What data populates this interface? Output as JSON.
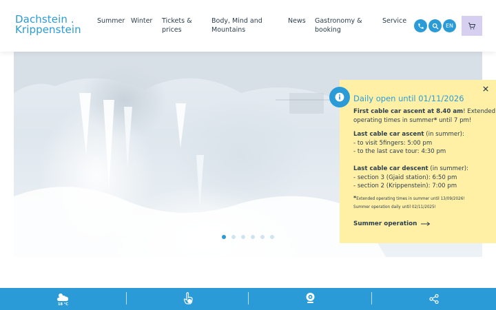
{
  "logo": {
    "line1": "Dachstein .",
    "line2": "Krippenstein"
  },
  "nav": [
    {
      "label": "Summer"
    },
    {
      "label": "Winter"
    },
    {
      "label": "Tickets &\nprices"
    },
    {
      "label": "Body, Mind and\nMountains"
    },
    {
      "label": "News"
    },
    {
      "label": "Gastronomy &\nbooking"
    },
    {
      "label": "Service"
    }
  ],
  "header_icons": {
    "phone": "phone-icon",
    "search": "search-icon",
    "language": "EN",
    "cart": "cart-icon"
  },
  "hero": {
    "slides": 6,
    "active_slide": 0
  },
  "popup": {
    "title": "Daily open until 01/11/2026",
    "line1_bold": "First cable car ascent at 8.40 am",
    "line1_rest": "! Extended",
    "line2_a": "operating times in summer",
    "line2_bold": "*",
    "line2_b": " until 7 pm!",
    "ascent_title": "Last cable car ascent",
    "ascent_suffix": " (in summer):",
    "ascent_1": "- to visit 5fingers: 5:00 pm",
    "ascent_2": "- to the last cave tour: 4:30 pm",
    "descent_title": "Last cable car descent",
    "descent_suffix": " (in summer):",
    "descent_1": "- section 3 (Gjaid station): 6:50 pm",
    "descent_2": "- section 2 (Krippenstein): 7:00 pm",
    "note_star": "*",
    "note_1": "Extended operating times in summer until 13/09/2026!",
    "note_2": "Summer operation daily until 02/11/2025!",
    "link": "Summer operation",
    "colors": {
      "accent": "#2a9bd7",
      "background": "#fff0a6",
      "text": "#2b3e4b"
    }
  },
  "bottom_bar": {
    "weather_temp": "18 °C",
    "icons": [
      "weather-icon",
      "hand-pointer-icon",
      "webcam-icon",
      "share-icon"
    ]
  }
}
